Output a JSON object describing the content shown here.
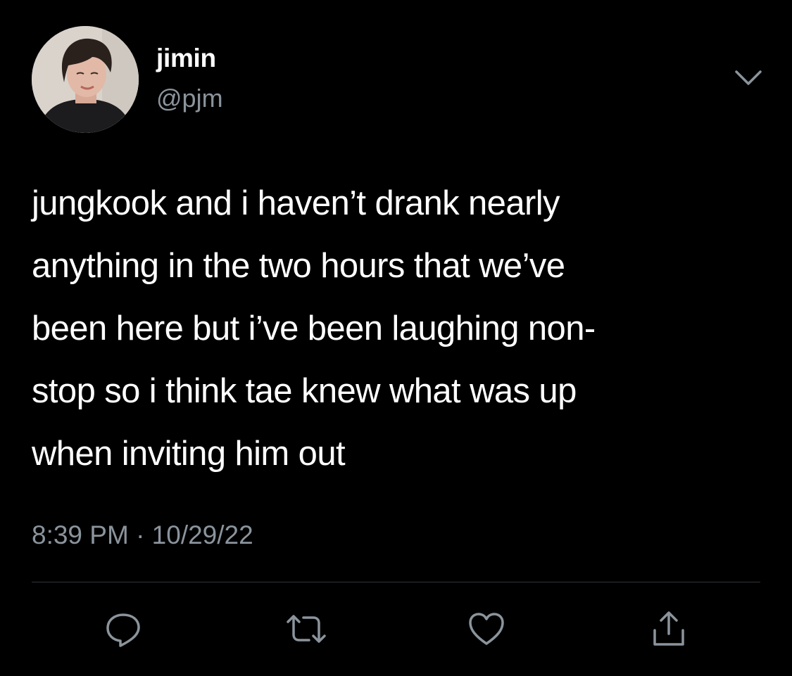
{
  "user": {
    "display_name": "jimin",
    "handle": "@pjm",
    "avatar": "profile-photo"
  },
  "tweet": {
    "text": "jungkook and i haven’t drank nearly\nanything in the two hours that we’ve\nbeen here but i’ve been laughing non-\nstop so i think tae knew what was up\nwhen inviting him out",
    "timestamp": "8:39 PM · 10/29/22"
  },
  "menu": {
    "icon": "chevron-down-icon"
  },
  "actions": [
    {
      "icon": "reply-icon"
    },
    {
      "icon": "retweet-icon"
    },
    {
      "icon": "like-icon"
    },
    {
      "icon": "share-icon"
    }
  ],
  "colors": {
    "background": "#000000",
    "primary_text": "#ffffff",
    "secondary_text": "#8b949c",
    "divider": "#2f3336",
    "icon": "#8b949c"
  }
}
